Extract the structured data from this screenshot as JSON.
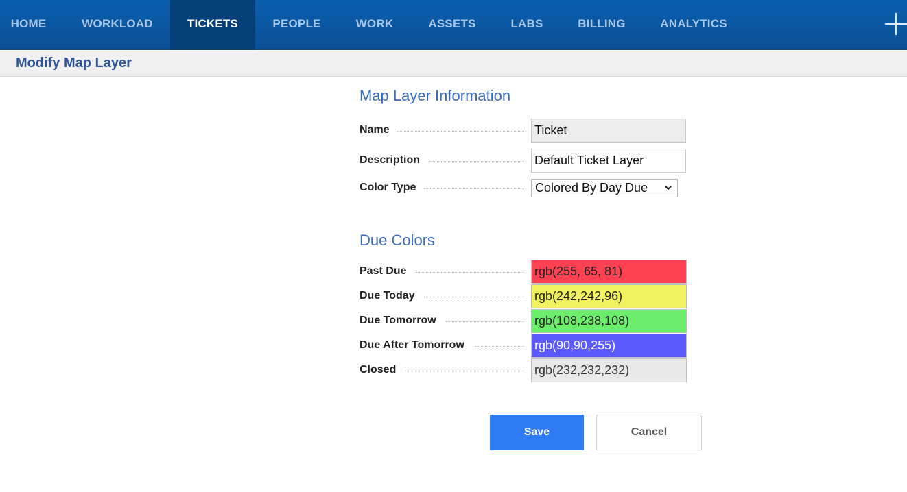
{
  "nav": {
    "items": [
      {
        "label": "HOME"
      },
      {
        "label": "WORKLOAD"
      },
      {
        "label": "TICKETS"
      },
      {
        "label": "PEOPLE"
      },
      {
        "label": "WORK"
      },
      {
        "label": "ASSETS"
      },
      {
        "label": "LABS"
      },
      {
        "label": "BILLING"
      },
      {
        "label": "ANALYTICS"
      }
    ],
    "active": "TICKETS",
    "add_icon": "plus-icon"
  },
  "page": {
    "title": "Modify Map Layer"
  },
  "layer_info": {
    "heading": "Map Layer Information",
    "name_label": "Name",
    "name_value": "Ticket",
    "description_label": "Description",
    "description_value": "Default Ticket Layer",
    "color_type_label": "Color Type",
    "color_type_value": "Colored By Day Due"
  },
  "due_colors": {
    "heading": "Due Colors",
    "rows": [
      {
        "label": "Past Due",
        "value": "rgb(255, 65, 81)",
        "color": "#ff4151",
        "text_color": "#222222"
      },
      {
        "label": "Due Today",
        "value": "rgb(242,242,96)",
        "color": "#f2f260",
        "text_color": "#222222"
      },
      {
        "label": "Due Tomorrow",
        "value": "rgb(108,238,108)",
        "color": "#6cee6c",
        "text_color": "#222222"
      },
      {
        "label": "Due After Tomorrow",
        "value": "rgb(90,90,255)",
        "color": "#5a5aff",
        "text_color": "#ffffff"
      },
      {
        "label": "Closed",
        "value": "rgb(232,232,232)",
        "color": "#e8e8e8",
        "text_color": "#333333"
      }
    ]
  },
  "actions": {
    "save_label": "Save",
    "cancel_label": "Cancel"
  },
  "colors": {
    "nav_bg": "#0a5fae",
    "nav_active": "#073f78",
    "accent": "#2f7bf5",
    "heading": "#3a6bbd"
  }
}
